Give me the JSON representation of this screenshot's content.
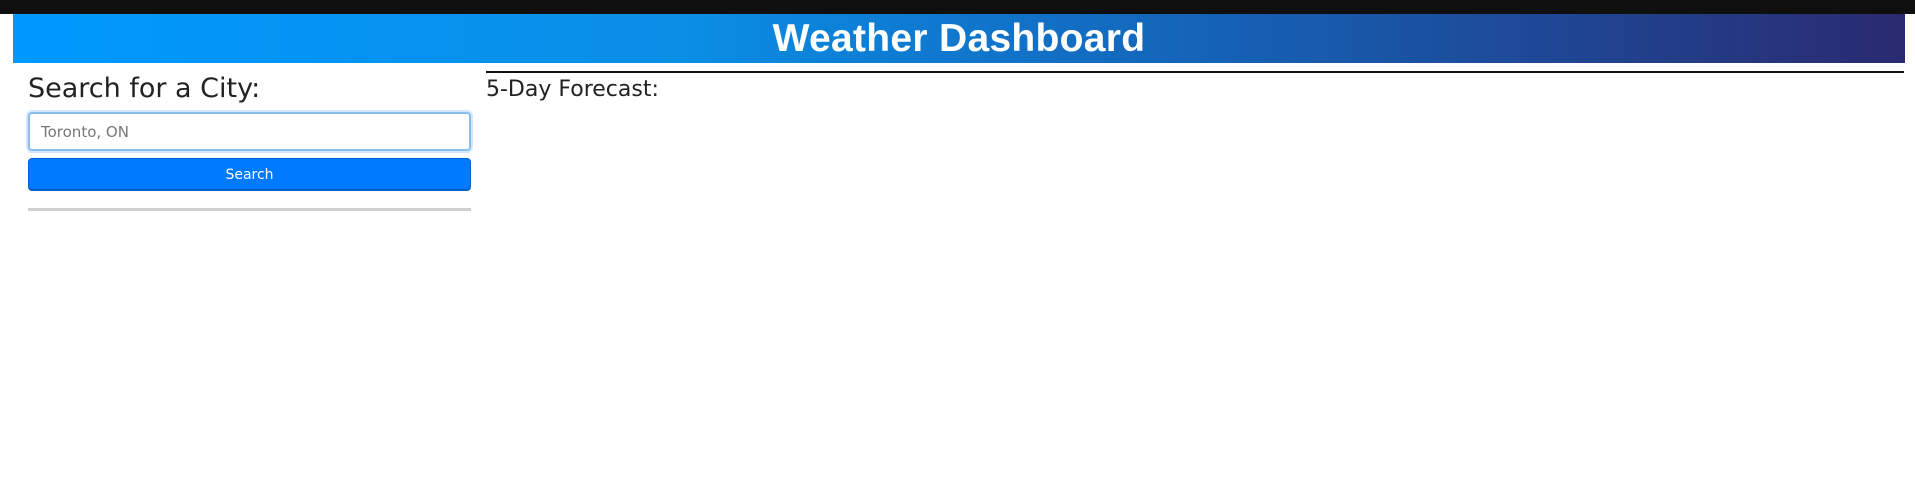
{
  "header": {
    "title": "Weather Dashboard"
  },
  "search": {
    "heading": "Search for a City:",
    "placeholder": "Toronto, ON",
    "value": "",
    "button_label": "Search"
  },
  "forecast": {
    "heading": "5-Day Forecast:"
  },
  "colors": {
    "header_gradient_start": "#0099ff",
    "header_gradient_end": "#2a2a70",
    "button_primary": "#007bff",
    "topbar": "#0f0f0f"
  }
}
